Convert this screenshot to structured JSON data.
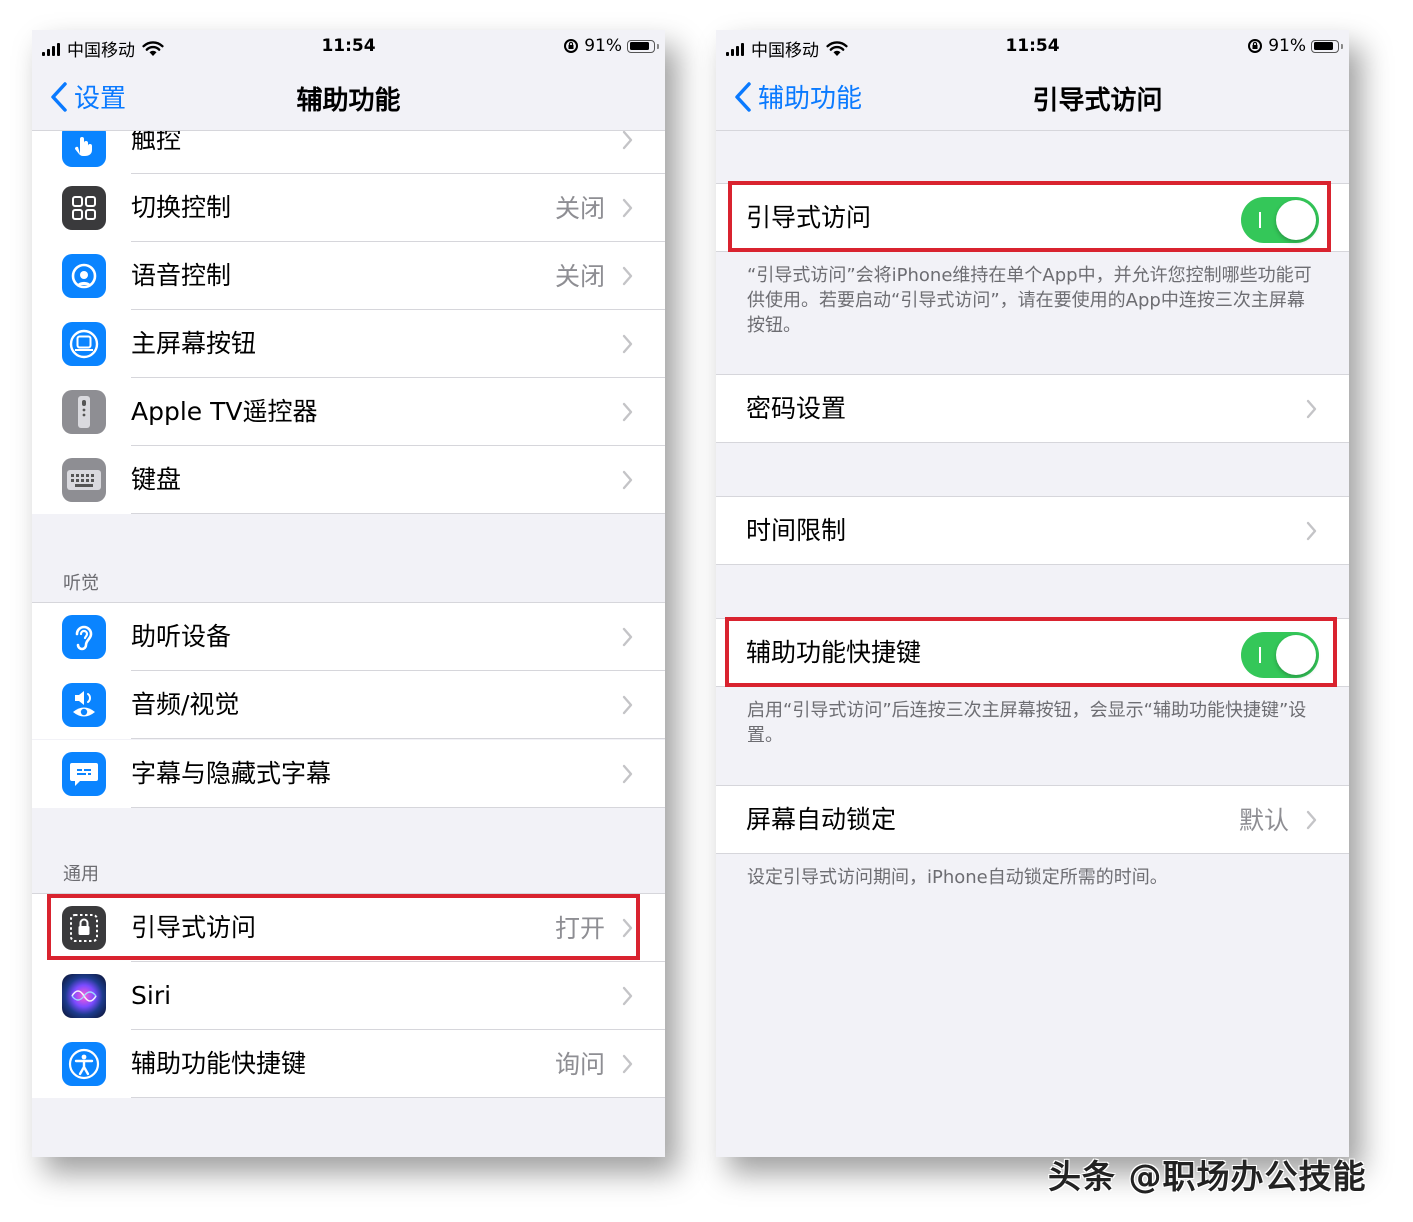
{
  "left": {
    "status": {
      "carrier": "中国移动",
      "time": "11:54",
      "battery": "91%",
      "battery_level": 0.91
    },
    "nav": {
      "back_label": "设置",
      "title": "辅助功能"
    },
    "rows_top": [
      {
        "label": "触控",
        "value": ""
      },
      {
        "label": "切换控制",
        "value": "关闭"
      },
      {
        "label": "语音控制",
        "value": "关闭"
      },
      {
        "label": "主屏幕按钮",
        "value": ""
      },
      {
        "label": "Apple TV遥控器",
        "value": ""
      },
      {
        "label": "键盘",
        "value": ""
      }
    ],
    "hearing": {
      "header": "听觉",
      "rows": [
        {
          "label": "助听设备",
          "value": ""
        },
        {
          "label": "音频/视觉",
          "value": ""
        },
        {
          "label": "字幕与隐藏式字幕",
          "value": ""
        }
      ]
    },
    "general": {
      "header": "通用",
      "rows": [
        {
          "label": "引导式访问",
          "value": "打开"
        },
        {
          "label": "Siri",
          "value": ""
        },
        {
          "label": "辅助功能快捷键",
          "value": "询问"
        }
      ]
    },
    "colors": {
      "accent": "#0a7aff",
      "highlight": "#d9232f"
    }
  },
  "right": {
    "status": {
      "carrier": "中国移动",
      "time": "11:54",
      "battery": "91%",
      "battery_level": 0.91
    },
    "nav": {
      "back_label": "辅助功能",
      "title": "引导式访问"
    },
    "guided_access": {
      "label": "引导式访问",
      "enabled": true,
      "footer": "“引导式访问”会将iPhone维持在单个App中，并允许您控制哪些功能可供使用。若要启动“引导式访问”，请在要使用的App中连按三次主屏幕按钮。"
    },
    "passcode": {
      "label": "密码设置"
    },
    "time_limits": {
      "label": "时间限制"
    },
    "accessibility_shortcut": {
      "label": "辅助功能快捷键",
      "enabled": true,
      "footer": "启用“引导式访问”后连按三次主屏幕按钮，会显示“辅助功能快捷键”设置。"
    },
    "auto_lock": {
      "label": "屏幕自动锁定",
      "value": "默认",
      "footer": "设定引导式访问期间，iPhone自动锁定所需的时间。"
    },
    "colors": {
      "toggle_on": "#34c759"
    }
  },
  "watermark": "头条 @职场办公技能"
}
